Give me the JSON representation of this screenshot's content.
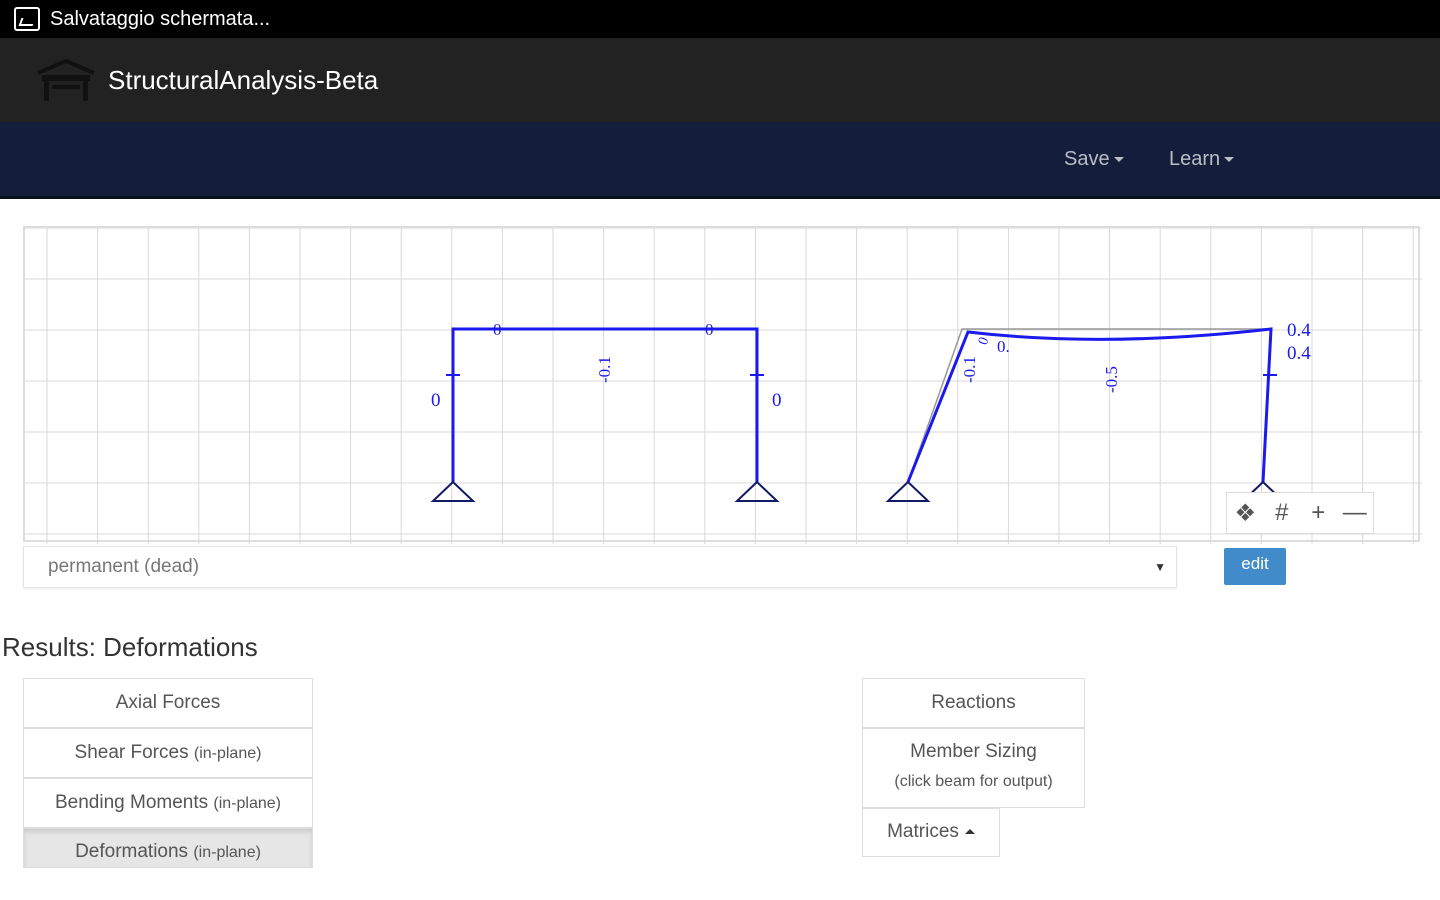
{
  "status": {
    "text": "Salvataggio schermata..."
  },
  "app": {
    "title": "StructuralAnalysis-Beta"
  },
  "nav": {
    "save": "Save",
    "learn": "Learn"
  },
  "diagram": {
    "left_frame": {
      "beam_label": "-0.1",
      "col_left_label": "0",
      "col_right_label": "0",
      "node_left": "0",
      "node_right": "0"
    },
    "right_frame": {
      "col_left_label": "-0.1",
      "node_label": "0.",
      "node_small": "0",
      "beam_label": "-0.5",
      "top_right_1": "0.4",
      "top_right_2": "0.4"
    },
    "colors": {
      "member": "#1a1aee",
      "grid": "#d9d9d9",
      "original": "#999999"
    }
  },
  "load_case": {
    "selected": "permanent (dead)",
    "edit_label": "edit"
  },
  "results": {
    "title": "Results: Deformations",
    "left_buttons": [
      {
        "main": "Axial Forces",
        "sub": ""
      },
      {
        "main": "Shear Forces",
        "sub": "(in-plane)"
      },
      {
        "main": "Bending Moments",
        "sub": "(in-plane)"
      },
      {
        "main": "Deformations",
        "sub": "(in-plane)"
      }
    ],
    "right_buttons": {
      "reactions": "Reactions",
      "member_sizing": "Member Sizing",
      "member_sizing_sub": "(click beam for output)",
      "matrices": "Matrices"
    }
  }
}
